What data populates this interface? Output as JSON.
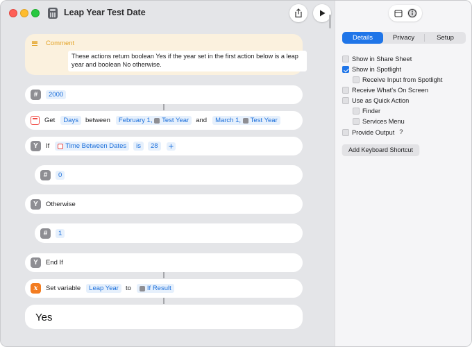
{
  "window": {
    "title": "Leap Year Test Date"
  },
  "comment": {
    "label": "Comment",
    "text": "These actions return boolean Yes if the year set in the first action below is a leap year and boolean No otherwise."
  },
  "actions": {
    "number1": {
      "value": "2000"
    },
    "get": {
      "label": "Get",
      "unit": "Days",
      "between": "between",
      "from_date": "February 1,",
      "from_var": "Test Year",
      "and": "and",
      "to_date": "March 1,",
      "to_var": "Test Year"
    },
    "if": {
      "label": "If",
      "var": "Time Between Dates",
      "op": "is",
      "value": "28",
      "plus": "+"
    },
    "number2": {
      "value": "0"
    },
    "otherwise": {
      "label": "Otherwise"
    },
    "number3": {
      "value": "1"
    },
    "endif": {
      "label": "End If"
    },
    "setvar": {
      "label": "Set variable",
      "name": "Leap Year",
      "to": "to",
      "value": "If Result"
    }
  },
  "result": {
    "value": "Yes"
  },
  "inspector": {
    "tabs": [
      "Details",
      "Privacy",
      "Setup"
    ],
    "active_tab": "Details",
    "options": [
      {
        "label": "Show in Share Sheet",
        "checked": false,
        "indent": false
      },
      {
        "label": "Show in Spotlight",
        "checked": true,
        "indent": false
      },
      {
        "label": "Receive Input from Spotlight",
        "checked": false,
        "indent": true
      },
      {
        "label": "Receive What's On Screen",
        "checked": false,
        "indent": false
      },
      {
        "label": "Use as Quick Action",
        "checked": false,
        "indent": false
      },
      {
        "label": "Finder",
        "checked": false,
        "indent": true
      },
      {
        "label": "Services Menu",
        "checked": false,
        "indent": true
      },
      {
        "label": "Provide Output",
        "checked": false,
        "indent": false
      }
    ],
    "help": "?",
    "keyboard_button": "Add Keyboard Shortcut"
  },
  "colors": {
    "accent": "#1f75e8",
    "token_bg": "#e6f0fc",
    "comment_bg": "#fbf1de"
  }
}
